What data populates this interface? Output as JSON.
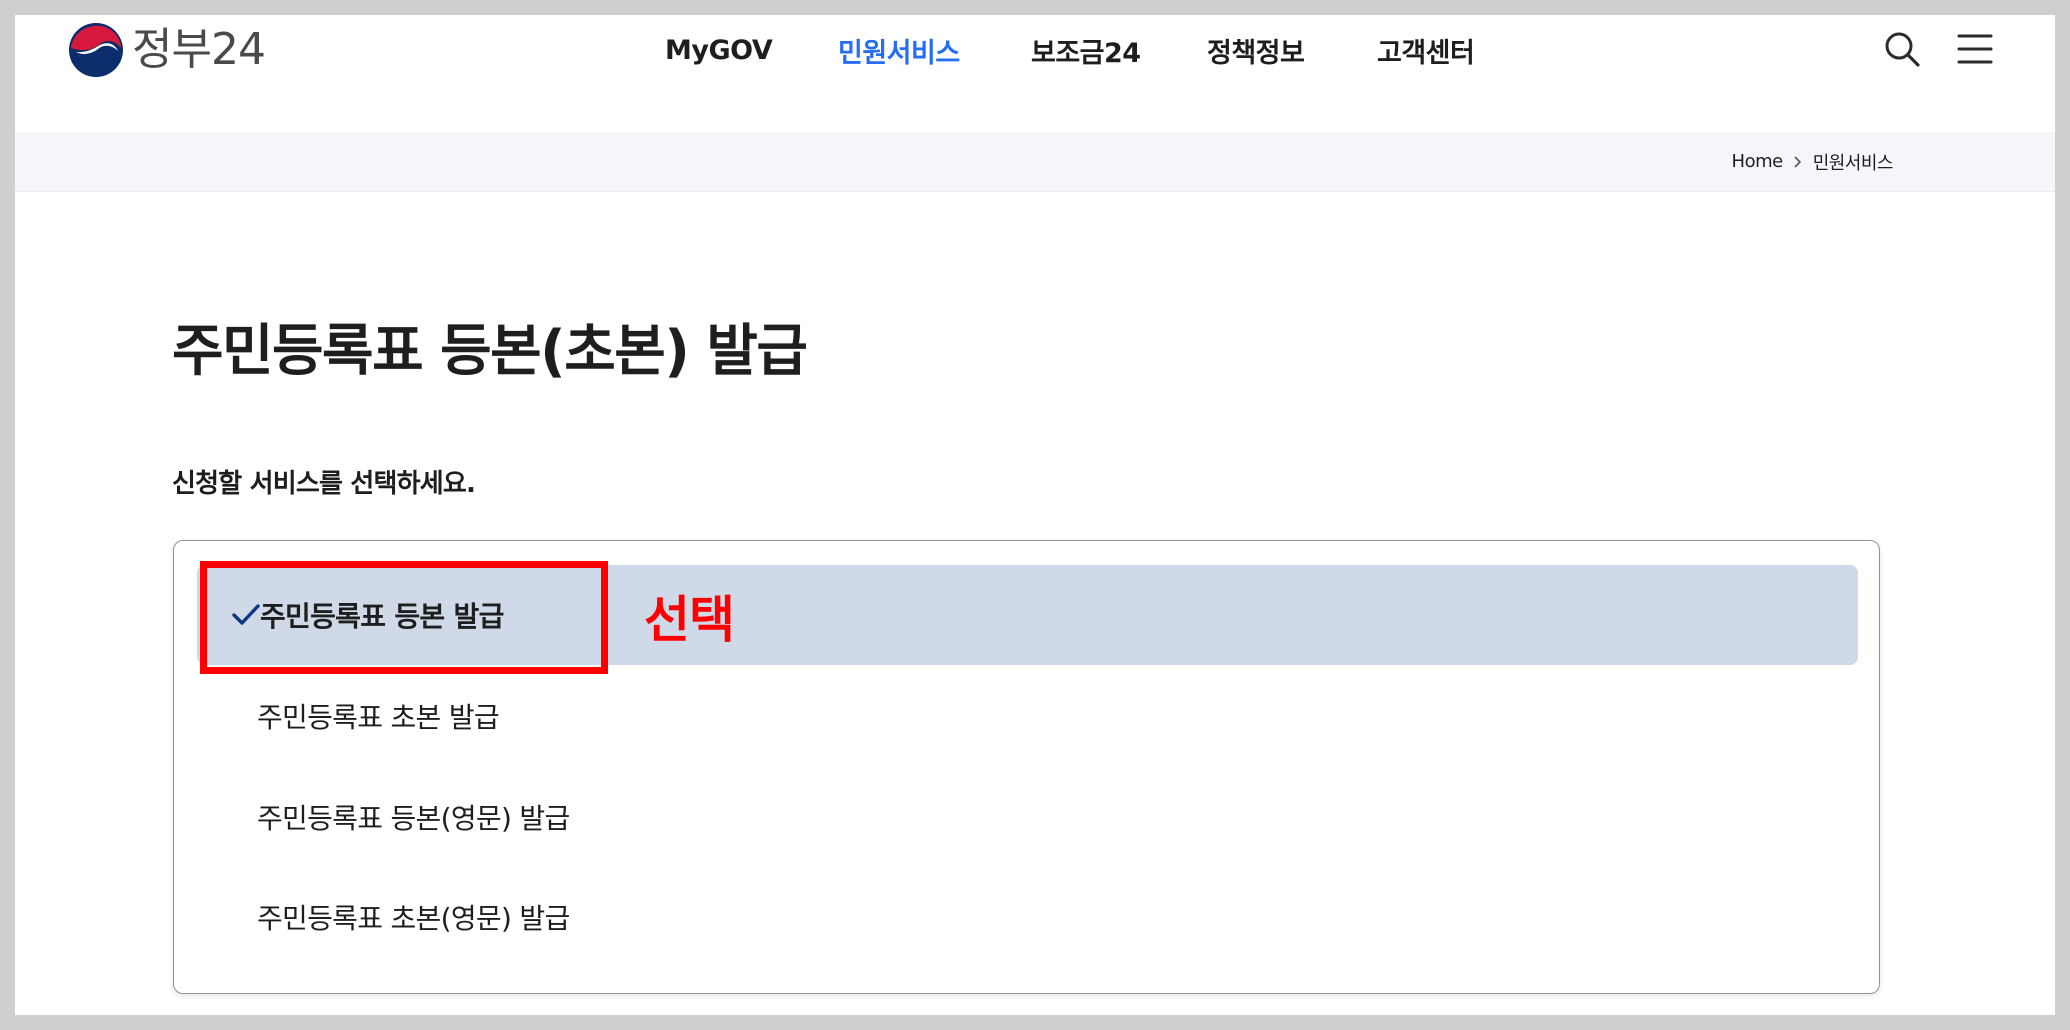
{
  "header": {
    "logo_text": "정부24",
    "nav": [
      {
        "label": "MyGOV",
        "active": false
      },
      {
        "label": "민원서비스",
        "active": true
      },
      {
        "label": "보조금24",
        "active": false
      },
      {
        "label": "정책정보",
        "active": false
      },
      {
        "label": "고객센터",
        "active": false
      }
    ],
    "search_icon": "search-icon",
    "menu_icon": "hamburger-menu-icon"
  },
  "breadcrumb": {
    "home": "Home",
    "current": "민원서비스"
  },
  "main": {
    "title": "주민등록표 등본(초본) 발급",
    "instruction": "신청할 서비스를 선택하세요.",
    "options": [
      {
        "label": "주민등록표 등본 발급",
        "selected": true
      },
      {
        "label": "주민등록표 초본 발급",
        "selected": false
      },
      {
        "label": "주민등록표 등본(영문) 발급",
        "selected": false
      },
      {
        "label": "주민등록표 초본(영문) 발급",
        "selected": false
      }
    ]
  },
  "annotation": {
    "label": "선택",
    "color": "#ff0000"
  },
  "colors": {
    "accent": "#256ef4",
    "selected_bg": "#d0d9e7",
    "check": "#0b3a82"
  }
}
